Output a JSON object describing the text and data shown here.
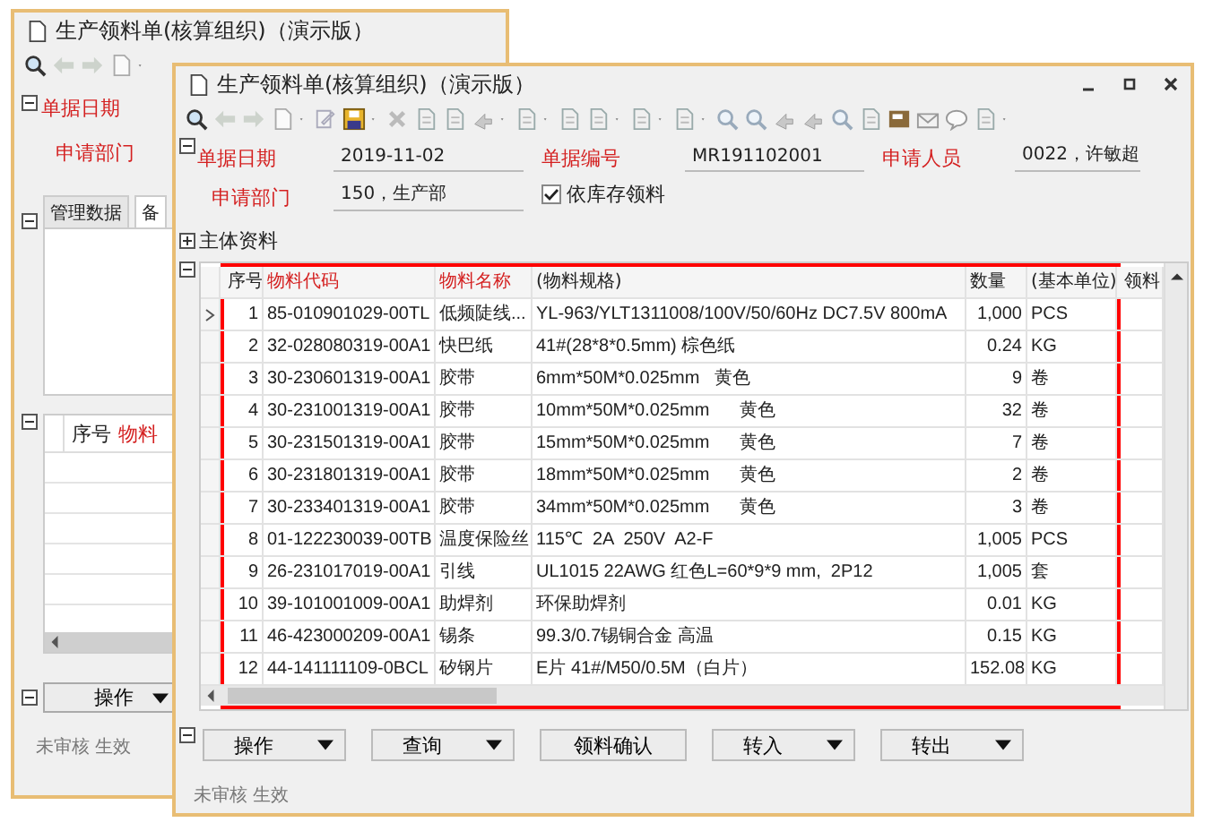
{
  "back_window": {
    "title": "生产领料单(核算组织)（演示版）",
    "header_expanded": true,
    "fields": [
      {
        "label": "单据日期"
      },
      {
        "label": "申请部门"
      }
    ],
    "tabs": [
      {
        "label": "管理数据",
        "selected": false
      },
      {
        "label": "备",
        "selected": true
      }
    ],
    "grid_columns": [
      {
        "label": "序号",
        "required": false
      },
      {
        "label": "物料",
        "required": true
      }
    ],
    "buttons": [
      {
        "label": "操作",
        "kind": "dropdown"
      }
    ],
    "status": "未审核 生效"
  },
  "window": {
    "title": "生产领料单(核算组织)（演示版）",
    "header": {
      "expanded": true,
      "fields": [
        {
          "label": "单据日期",
          "value": "2019-11-02"
        },
        {
          "label": "单据编号",
          "value": "MR191102001"
        },
        {
          "label": "申请人员",
          "value": "0022，许敏超"
        },
        {
          "label": "申请部门",
          "value": "150，生产部"
        }
      ],
      "checkbox": {
        "label": "依库存领料",
        "checked": true
      }
    },
    "body_info": {
      "label": "主体资料",
      "expanded": false
    },
    "table": {
      "expanded": true,
      "columns": [
        {
          "label": "序号",
          "required": false
        },
        {
          "label": "物料代码",
          "required": true
        },
        {
          "label": "物料名称",
          "required": true
        },
        {
          "label": "(物料规格)",
          "required": false
        },
        {
          "label": "数量",
          "required": false
        },
        {
          "label": "(基本单位)",
          "required": false
        },
        {
          "label": "领料",
          "required": false
        }
      ],
      "rows": [
        {
          "selected": true,
          "cells": [
            "1",
            "85-010901029-00TL",
            "低频陡线...",
            "YL-963/YLT1311008/100V/50/60Hz DC7.5V 800mA",
            "1,000",
            "PCS"
          ]
        },
        {
          "selected": false,
          "cells": [
            "2",
            "32-028080319-00A1",
            "快巴纸",
            "41#(28*8*0.5mm) 棕色纸",
            "0.24",
            "KG"
          ]
        },
        {
          "selected": false,
          "cells": [
            "3",
            "30-230601319-00A1",
            "胶带",
            "6mm*50M*0.025mm   黄色",
            "9",
            "卷"
          ]
        },
        {
          "selected": false,
          "cells": [
            "4",
            "30-231001319-00A1",
            "胶带",
            "10mm*50M*0.025mm      黄色",
            "32",
            "卷"
          ]
        },
        {
          "selected": false,
          "cells": [
            "5",
            "30-231501319-00A1",
            "胶带",
            "15mm*50M*0.025mm      黄色",
            "7",
            "卷"
          ]
        },
        {
          "selected": false,
          "cells": [
            "6",
            "30-231801319-00A1",
            "胶带",
            "18mm*50M*0.025mm      黄色",
            "2",
            "卷"
          ]
        },
        {
          "selected": false,
          "cells": [
            "7",
            "30-233401319-00A1",
            "胶带",
            "34mm*50M*0.025mm      黄色",
            "3",
            "卷"
          ]
        },
        {
          "selected": false,
          "cells": [
            "8",
            "01-122230039-00TB",
            "温度保险丝",
            "115℃  2A  250V  A2-F",
            "1,005",
            "PCS"
          ]
        },
        {
          "selected": false,
          "cells": [
            "9",
            "26-231017019-00A1",
            "引线",
            "UL1015 22AWG 红色L=60*9*9 mm,  2P12",
            "1,005",
            "套"
          ]
        },
        {
          "selected": false,
          "cells": [
            "10",
            "39-101001009-00A1",
            "助焊剂",
            "环保助焊剂",
            "0.01",
            "KG"
          ]
        },
        {
          "selected": false,
          "cells": [
            "11",
            "46-423000209-00A1",
            "锡条",
            "99.3/0.7锡铜合金 高温",
            "0.15",
            "KG"
          ]
        },
        {
          "selected": false,
          "cells": [
            "12",
            "44-141111109-0BCL",
            "矽钢片",
            "E片 41#/M50/0.5M（白片）",
            "152.08",
            "KG"
          ]
        }
      ]
    },
    "buttons_expanded": true,
    "buttons": [
      {
        "label": "操作",
        "kind": "dropdown"
      },
      {
        "label": "查询",
        "kind": "dropdown"
      },
      {
        "label": "领料确认",
        "kind": "plain"
      },
      {
        "label": "转入",
        "kind": "dropdown"
      },
      {
        "label": "转出",
        "kind": "dropdown"
      }
    ],
    "status": "未审核 生效"
  }
}
